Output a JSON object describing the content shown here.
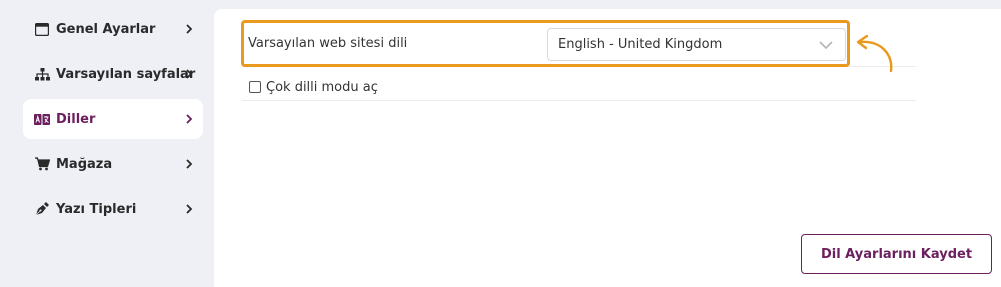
{
  "sidebar": {
    "items": [
      {
        "label": "Genel Ayarlar",
        "icon": "window-icon",
        "active": false
      },
      {
        "label": "Varsayılan sayfalar",
        "icon": "sitemap-icon",
        "active": false
      },
      {
        "label": "Diller",
        "icon": "language-icon",
        "active": true
      },
      {
        "label": "Mağaza",
        "icon": "cart-icon",
        "active": false
      },
      {
        "label": "Yazı Tipleri",
        "icon": "pen-nib-icon",
        "active": false
      }
    ]
  },
  "language_settings": {
    "default_language_label": "Varsayılan web sitesi dili",
    "default_language_value": "English - United Kingdom",
    "multilingual_label": "Çok dilli modu aç",
    "multilingual_checked": false,
    "save_label": "Dil Ayarlarını Kaydet"
  },
  "colors": {
    "accent": "#6b1f5e",
    "highlight": "#e8991e",
    "sidebar_bg": "#eef0f6"
  }
}
